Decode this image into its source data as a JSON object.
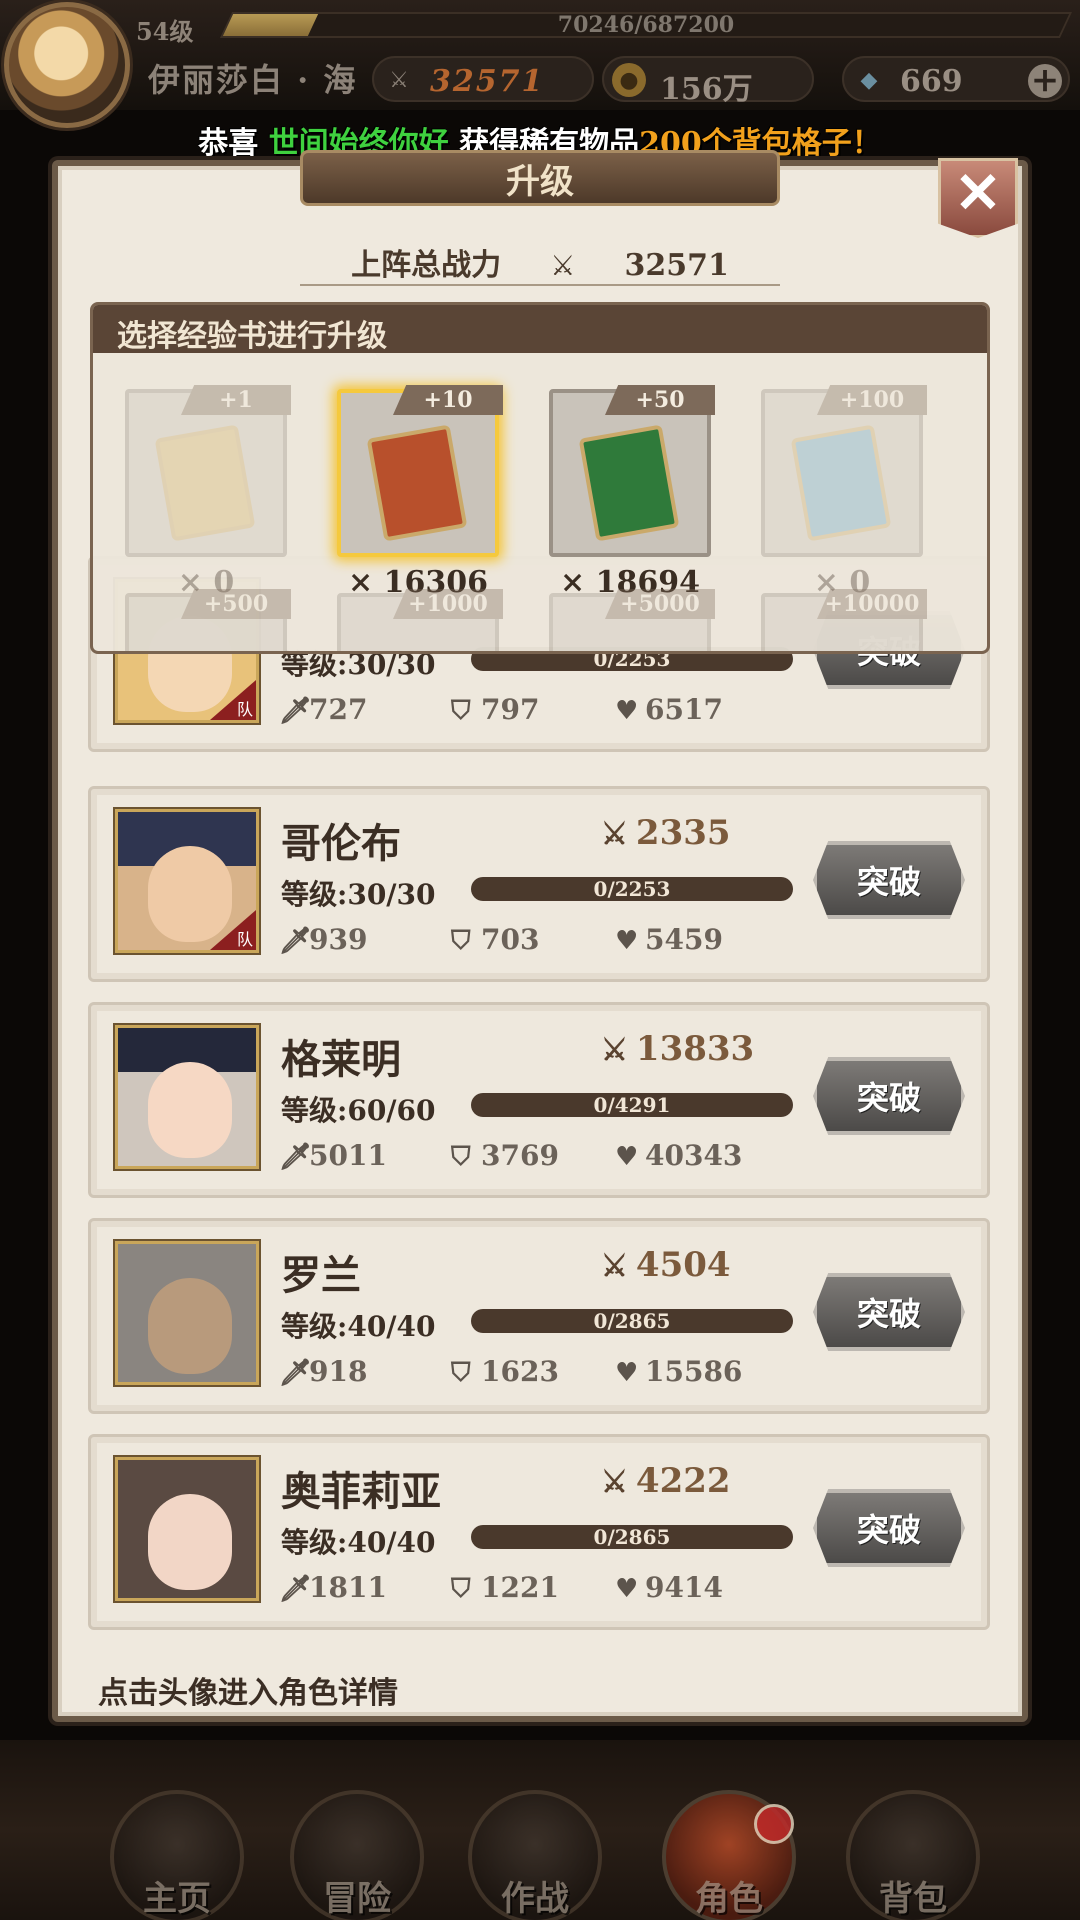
{
  "player": {
    "level": "54级",
    "xp": "70246/687200",
    "xp_progress": 0.102,
    "name": "伊丽莎白 · 海",
    "power": "32571",
    "gold": "156万",
    "gems": "669"
  },
  "announcement": {
    "prefix": "恭喜",
    "user": "世间始终你好",
    "middle": "获得稀有物品",
    "item": "200个背包格子！"
  },
  "panel": {
    "title": "升级",
    "total_power_label": "上阵总战力",
    "total_power_value": "32571",
    "hint": "点击头像进入角色详情"
  },
  "exp_books": {
    "header": "选择经验书进行升级",
    "items": [
      {
        "badge": "+1",
        "count": "× 0",
        "state": "disabled",
        "color": "#d6b46a"
      },
      {
        "badge": "+10",
        "count": "× 16306",
        "state": "selected",
        "color": "#b8502c"
      },
      {
        "badge": "+50",
        "count": "× 18694",
        "state": "normal",
        "color": "#2f7a3a"
      },
      {
        "badge": "+100",
        "count": "× 0",
        "state": "disabled",
        "color": "#6aa8c9"
      }
    ],
    "row2_badges": [
      "+500",
      "+1000",
      "+5000",
      "+10000"
    ]
  },
  "heroes": [
    {
      "name": "",
      "level": "等级:30/30",
      "exp": "0/2253",
      "atk": "727",
      "def": "797",
      "hp": "6517",
      "power": "",
      "button": "突破"
    },
    {
      "name": "哥伦布",
      "level": "等级:30/30",
      "exp": "0/2253",
      "atk": "939",
      "def": "703",
      "hp": "5459",
      "power": "2335",
      "button": "突破"
    },
    {
      "name": "格莱明",
      "level": "等级:60/60",
      "exp": "0/4291",
      "atk": "5011",
      "def": "3769",
      "hp": "40343",
      "power": "13833",
      "button": "突破"
    },
    {
      "name": "罗兰",
      "level": "等级:40/40",
      "exp": "0/2865",
      "atk": "918",
      "def": "1623",
      "hp": "15586",
      "power": "4504",
      "button": "突破"
    },
    {
      "name": "奥菲莉亚",
      "level": "等级:40/40",
      "exp": "0/2865",
      "atk": "1811",
      "def": "1221",
      "hp": "9414",
      "power": "4222",
      "button": "突破"
    }
  ],
  "nav": {
    "items": [
      {
        "label": "主页",
        "icon": "castle-icon"
      },
      {
        "label": "冒险",
        "icon": "globe-icon"
      },
      {
        "label": "作战",
        "icon": "warrior-icon"
      },
      {
        "label": "角色",
        "icon": "character-book-icon",
        "active": true
      },
      {
        "label": "背包",
        "icon": "backpack-icon"
      }
    ]
  }
}
